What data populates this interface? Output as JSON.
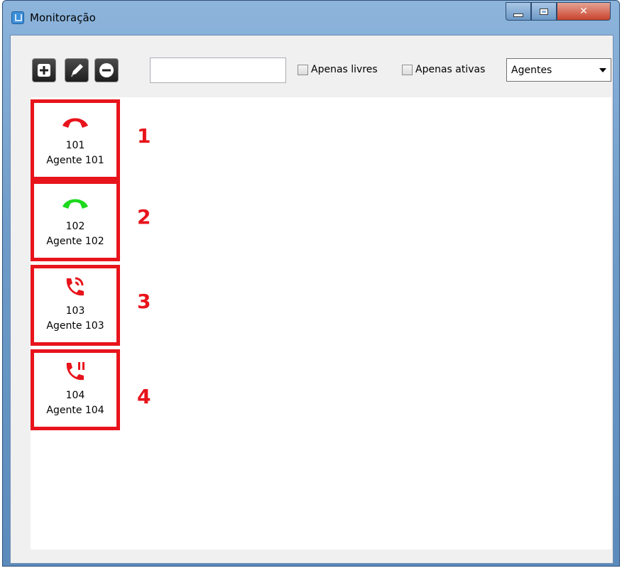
{
  "window": {
    "title": "Monitoração"
  },
  "toolbar": {
    "search_value": "",
    "filter_free_label": "Apenas livres",
    "filter_active_label": "Apenas ativas",
    "type_select_value": "Agentes"
  },
  "agents": [
    {
      "number": "101",
      "name": "Agente 101",
      "status_icon": "phone-hangup-red-icon",
      "marker": "1"
    },
    {
      "number": "102",
      "name": "Agente 102",
      "status_icon": "phone-hangup-green-icon",
      "marker": "2"
    },
    {
      "number": "103",
      "name": "Agente 103",
      "status_icon": "phone-ringing-red-icon",
      "marker": "3"
    },
    {
      "number": "104",
      "name": "Agente 104",
      "status_icon": "phone-hold-red-icon",
      "marker": "4"
    }
  ],
  "colors": {
    "alert_red": "#e8141c",
    "free_green": "#1ed91e"
  }
}
